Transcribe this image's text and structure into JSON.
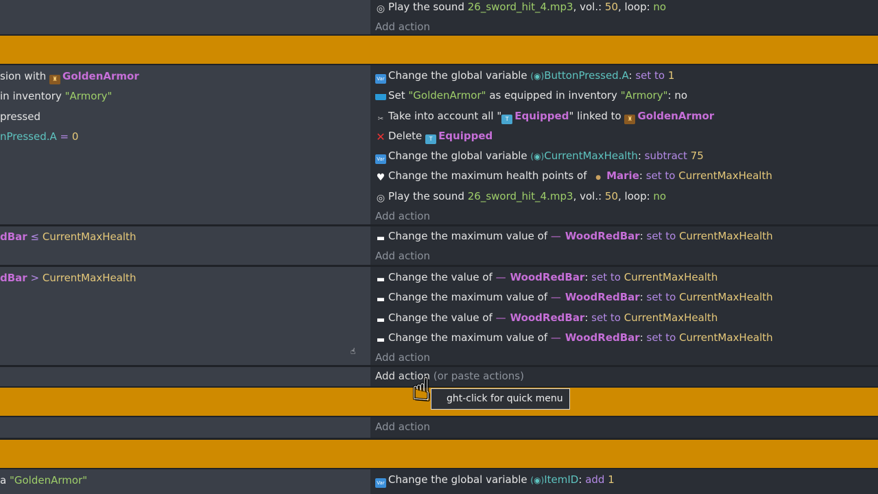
{
  "add_action": "Add action",
  "paste_actions": "(or paste actions)",
  "tooltip": "ght-click for quick menu",
  "row0": {
    "action": [
      "Play the sound ",
      "26_sword_hit_4.mp3",
      ", vol.: ",
      "50",
      ", loop: ",
      "no"
    ]
  },
  "event1": {
    "conditions": [
      [
        "sion with ",
        "GoldenArmor"
      ],
      [
        "in inventory ",
        "\"Armory\""
      ],
      [
        "pressed"
      ],
      [
        "nPressed.A",
        "=",
        "0"
      ]
    ],
    "actions": {
      "a1": [
        "Change the global variable ",
        "ButtonPressed.A",
        ": ",
        "set to",
        "1"
      ],
      "a2": [
        "Set ",
        "\"GoldenArmor\"",
        " as equipped in inventory ",
        "\"Armory\"",
        ": no"
      ],
      "a3": [
        "Take into account all \"",
        "Equipped",
        "\" linked to ",
        "GoldenArmor"
      ],
      "a4": [
        "Delete ",
        "Equipped"
      ],
      "a5": [
        "Change the global variable ",
        "CurrentMaxHealth",
        ": ",
        "subtract",
        "75"
      ],
      "a6": [
        "Change the maximum health points of ",
        "Marie",
        ": ",
        "set to",
        "CurrentMaxHealth"
      ],
      "a7": [
        "Play the sound ",
        "26_sword_hit_4.mp3",
        ", vol.: ",
        "50",
        ", loop: ",
        "no"
      ]
    }
  },
  "event2": {
    "condition": [
      "dBar",
      "≤",
      "CurrentMaxHealth"
    ],
    "action": [
      "Change the maximum value of ",
      "WoodRedBar",
      ": ",
      "set to",
      "CurrentMaxHealth"
    ]
  },
  "event3": {
    "condition": [
      "dBar",
      ">",
      "CurrentMaxHealth"
    ],
    "actions": [
      [
        "Change the value of ",
        "WoodRedBar",
        ": ",
        "set to",
        "CurrentMaxHealth"
      ],
      [
        "Change the maximum value of ",
        "WoodRedBar",
        ": ",
        "set to",
        "CurrentMaxHealth"
      ],
      [
        "Change the value of ",
        "WoodRedBar",
        ": ",
        "set to",
        "CurrentMaxHealth"
      ],
      [
        "Change the maximum value of ",
        "WoodRedBar",
        ": ",
        "set to",
        "CurrentMaxHealth"
      ]
    ]
  },
  "event_last": {
    "condition": [
      "a ",
      "\"GoldenArmor\""
    ],
    "action": [
      "Change the global variable ",
      "ItemID",
      ": ",
      "add",
      "1"
    ]
  },
  "colors": {
    "group_bar": "#cf8a00",
    "conditions_bg": "#3a3f48",
    "actions_bg": "#2a2e35"
  }
}
